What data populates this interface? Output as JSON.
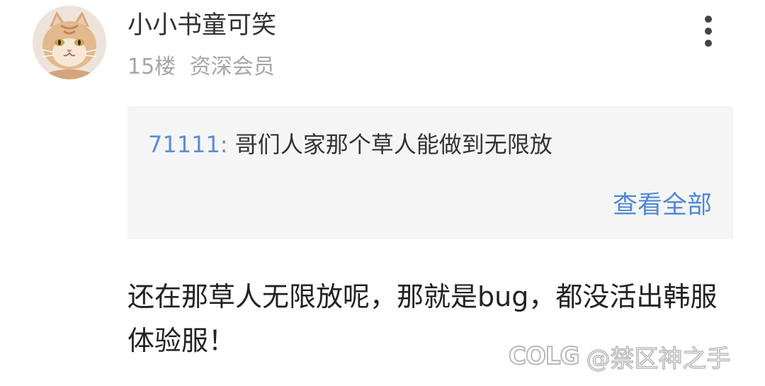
{
  "post": {
    "username": "小小书童可笑",
    "floor": "15楼",
    "member_level": "资深会员"
  },
  "quote": {
    "author": "71111:",
    "text": " 哥们人家那个草人能做到无限放",
    "view_all": "查看全部"
  },
  "comment": {
    "text": "还在那草人无限放呢，那就是bug，都没活出韩服体验服！"
  },
  "watermark": {
    "logo": "COLG",
    "text": "@禁区神之手"
  },
  "icons": {
    "more": "more-vertical-icon",
    "avatar": "cat-avatar"
  },
  "colors": {
    "link_blue": "#4f88d5",
    "quote_bg": "#f5f5f5",
    "meta_gray": "#a6a6a6"
  }
}
